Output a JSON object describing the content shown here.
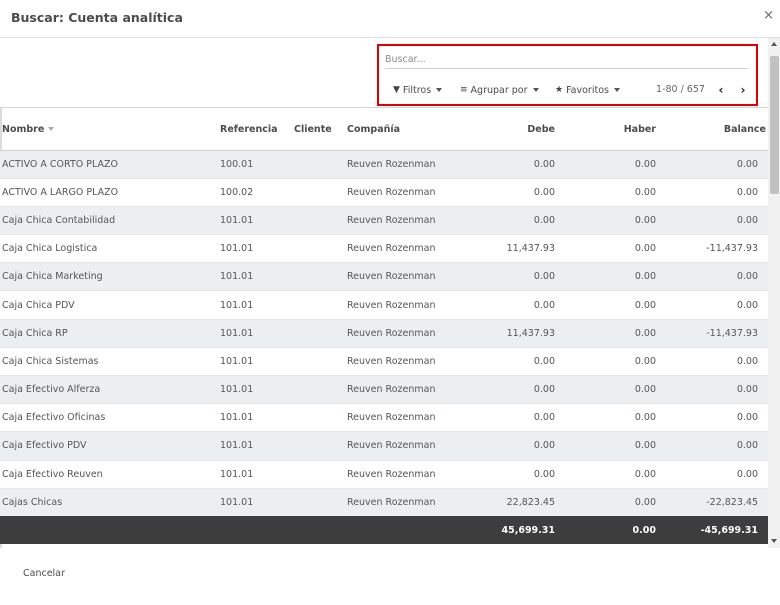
{
  "dialog": {
    "title": "Buscar: Cuenta analítica",
    "close_label": "×"
  },
  "search": {
    "placeholder": "Buscar..."
  },
  "toolbar": {
    "filters_label": "Filtros",
    "group_by_label": "Agrupar por",
    "favorites_label": "Favoritos"
  },
  "pager": {
    "value": "1-80 / 657",
    "prev_label": "‹",
    "next_label": "›"
  },
  "table": {
    "columns": [
      "Nombre",
      "Referencia",
      "Cliente",
      "Compañía",
      "Debe",
      "Haber",
      "Balance"
    ],
    "rows": [
      [
        "ACTIVO A CORTO PLAZO",
        "100.01",
        "",
        "Reuven Rozenman",
        "0.00",
        "0.00",
        "0.00"
      ],
      [
        "ACTIVO A LARGO PLAZO",
        "100.02",
        "",
        "Reuven Rozenman",
        "0.00",
        "0.00",
        "0.00"
      ],
      [
        "Caja Chica Contabilidad",
        "101.01",
        "",
        "Reuven Rozenman",
        "0.00",
        "0.00",
        "0.00"
      ],
      [
        "Caja Chica Logistica",
        "101.01",
        "",
        "Reuven Rozenman",
        "11,437.93",
        "0.00",
        "-11,437.93"
      ],
      [
        "Caja Chica Marketing",
        "101.01",
        "",
        "Reuven Rozenman",
        "0.00",
        "0.00",
        "0.00"
      ],
      [
        "Caja Chica PDV",
        "101.01",
        "",
        "Reuven Rozenman",
        "0.00",
        "0.00",
        "0.00"
      ],
      [
        "Caja Chica RP",
        "101.01",
        "",
        "Reuven Rozenman",
        "11,437.93",
        "0.00",
        "-11,437.93"
      ],
      [
        "Caja Chica Sistemas",
        "101.01",
        "",
        "Reuven Rozenman",
        "0.00",
        "0.00",
        "0.00"
      ],
      [
        "Caja Efectivo Alferza",
        "101.01",
        "",
        "Reuven Rozenman",
        "0.00",
        "0.00",
        "0.00"
      ],
      [
        "Caja Efectivo Oficinas",
        "101.01",
        "",
        "Reuven Rozenman",
        "0.00",
        "0.00",
        "0.00"
      ],
      [
        "Caja Efectivo PDV",
        "101.01",
        "",
        "Reuven Rozenman",
        "0.00",
        "0.00",
        "0.00"
      ],
      [
        "Caja Efectivo Reuven",
        "101.01",
        "",
        "Reuven Rozenman",
        "0.00",
        "0.00",
        "0.00"
      ],
      [
        "Cajas Chicas",
        "101.01",
        "",
        "Reuven Rozenman",
        "22,823.45",
        "0.00",
        "-22,823.45"
      ]
    ],
    "totals": {
      "debe": "45,699.31",
      "haber": "0.00",
      "balance": "-45,699.31"
    }
  },
  "footer": {
    "cancel_label": "Cancelar"
  },
  "colors": {
    "highlight": "#e00000",
    "row_striped": "#eceff2",
    "totals_bg": "#3d3d3d"
  }
}
